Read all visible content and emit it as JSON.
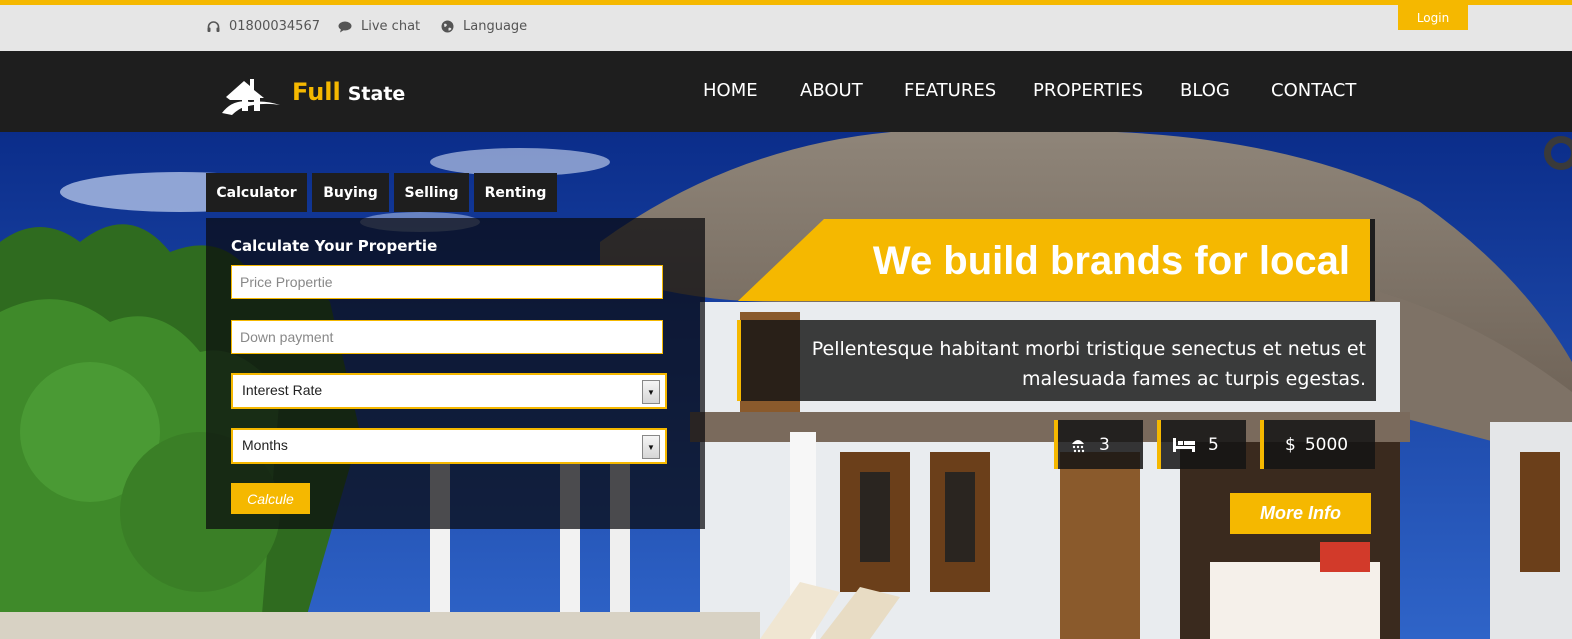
{
  "topbar": {
    "phone": "01800034567",
    "chat": "Live chat",
    "language": "Language",
    "login": "Login"
  },
  "brand": {
    "word1": "Full",
    "word2": "State"
  },
  "nav": {
    "items": [
      "HOME",
      "ABOUT",
      "FEATURES",
      "PROPERTIES",
      "BLOG",
      "CONTACT"
    ]
  },
  "tabs": [
    "Calculator",
    "Buying",
    "Selling",
    "Renting"
  ],
  "calculator": {
    "title": "Calculate Your Propertie",
    "price_placeholder": "Price Propertie",
    "down_placeholder": "Down payment",
    "rate_selected": "Interest Rate",
    "months_selected": "Months",
    "button": "Calcule"
  },
  "hero": {
    "headline": "We build brands for local",
    "subtitle_line1": "Pellentesque habitant morbi tristique senectus et netus et",
    "subtitle_line2": "malesuada fames ac turpis egestas.",
    "baths": "3",
    "beds": "5",
    "currency": "$",
    "price": "5000",
    "more_info": "More Info"
  },
  "colors": {
    "accent": "#f5b800",
    "dark": "#1e1e1e",
    "topbar": "#e6e6e6"
  }
}
